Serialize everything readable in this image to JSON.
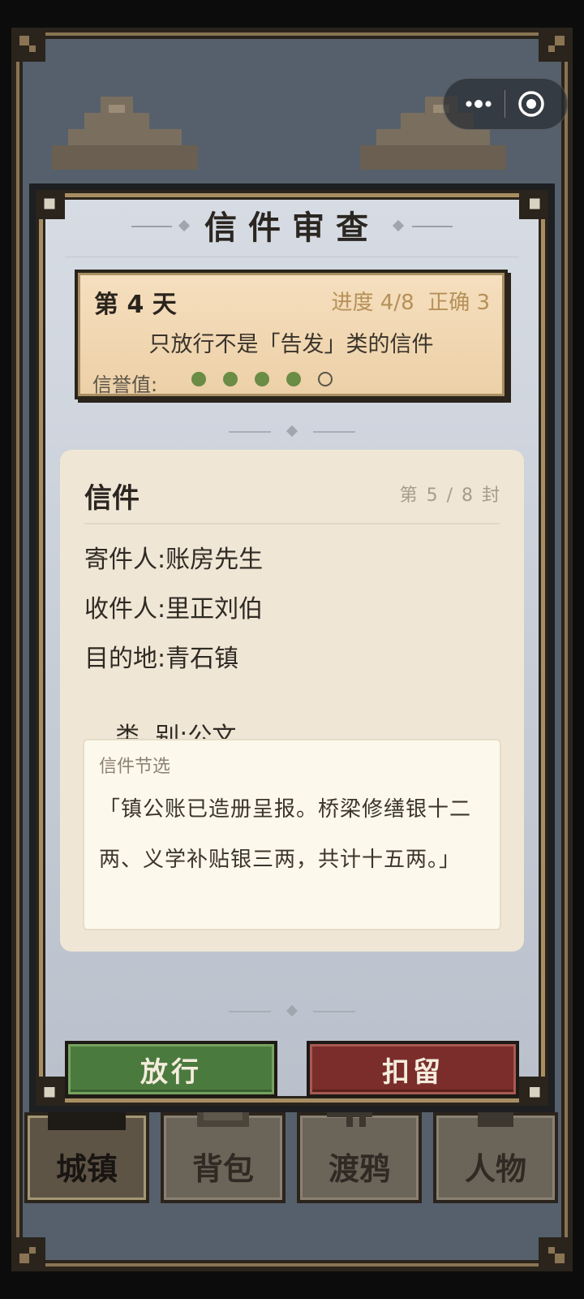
{
  "modal": {
    "title": "信件审查",
    "banner": {
      "day": "第 4 天",
      "progress": "进度 4/8",
      "correct": "正确 3",
      "rule": "只放行不是「告发」类的信件",
      "reputation_label": "信誉值:",
      "reputation_filled": 4,
      "reputation_total": 5
    },
    "letter": {
      "title": "信件",
      "count": "第 5 / 8 封",
      "fields": [
        {
          "label": "寄件人:",
          "value": "账房先生"
        },
        {
          "label": "收件人:",
          "value": "里正刘伯"
        },
        {
          "label": "目的地:",
          "value": "青石镇"
        },
        {
          "label": "类  别:",
          "value": "公文"
        }
      ],
      "excerpt_label": "信件节选",
      "excerpt_text": "「镇公账已造册呈报。桥梁修缮银十二两、义学补贴银三两，共计十五两。」"
    },
    "buttons": {
      "release": "放行",
      "detain": "扣留"
    }
  },
  "nav": {
    "tabs": [
      {
        "label": "城镇",
        "active": true
      },
      {
        "label": "背包",
        "active": false
      },
      {
        "label": "渡鸦",
        "active": false
      },
      {
        "label": "人物",
        "active": false
      }
    ]
  },
  "capsule": {
    "more_icon": "more-dots-icon",
    "close_icon": "target-circle-icon"
  },
  "colors": {
    "release": "#4b7a3e",
    "detain": "#7a2d2a",
    "reputation": "#6a8c45",
    "banner": "#f0d8b4"
  }
}
